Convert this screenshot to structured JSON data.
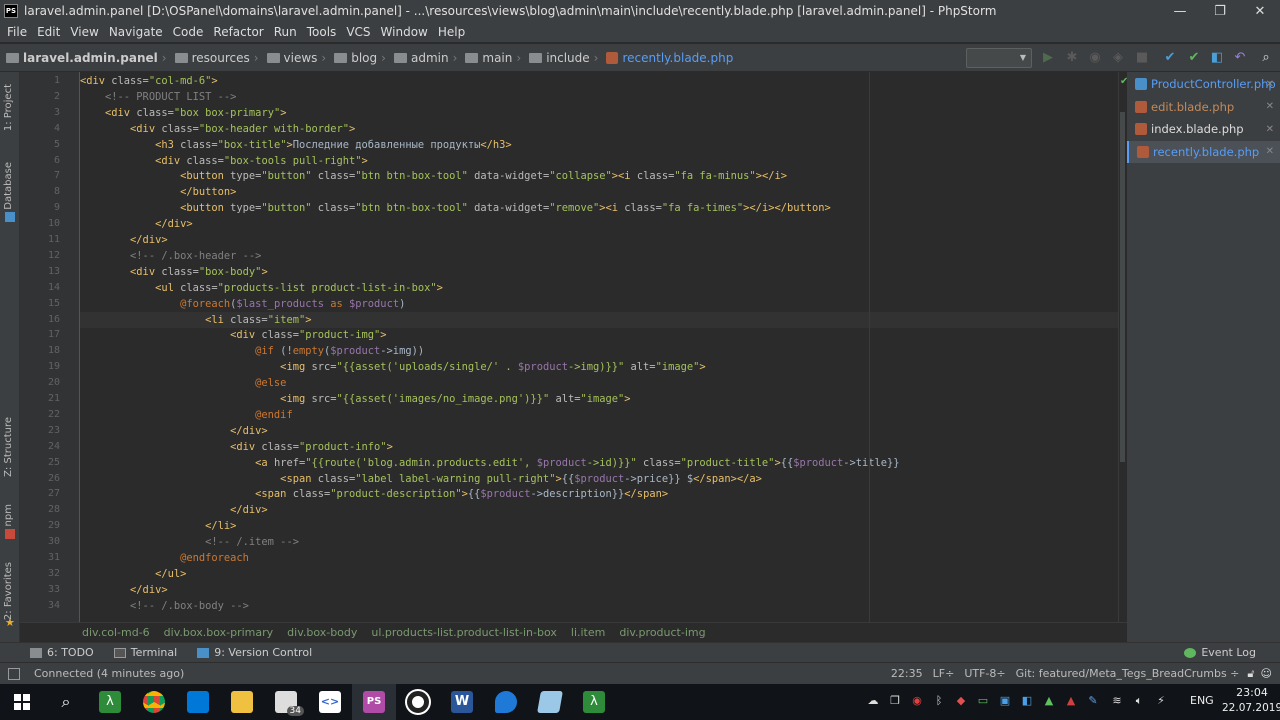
{
  "window": {
    "title": "laravel.admin.panel [D:\\OSPanel\\domains\\laravel.admin.panel] - ...\\resources\\views\\blog\\admin\\main\\include\\recently.blade.php [laravel.admin.panel] - PhpStorm",
    "app_icon": "PS",
    "minimize_glyph": "—",
    "maximize_glyph": "❐",
    "close_glyph": "✕"
  },
  "menu": [
    "File",
    "Edit",
    "View",
    "Navigate",
    "Code",
    "Refactor",
    "Run",
    "Tools",
    "VCS",
    "Window",
    "Help"
  ],
  "breadcrumbs": [
    "laravel.admin.panel",
    "resources",
    "views",
    "blog",
    "admin",
    "main",
    "include",
    "recently.blade.php"
  ],
  "left_tool_tabs": [
    "1: Project",
    "Database",
    "Z: Structure",
    "npm",
    "2: Favorites"
  ],
  "line_numbers": [
    "1",
    "2",
    "3",
    "4",
    "5",
    "6",
    "7",
    "8",
    "9",
    "10",
    "11",
    "12",
    "13",
    "14",
    "15",
    "16",
    "17",
    "18",
    "19",
    "20",
    "21",
    "22",
    "23",
    "24",
    "25",
    "26",
    "27",
    "28",
    "29",
    "30",
    "31",
    "32",
    "33",
    "34"
  ],
  "code_lines": [
    [
      [
        "t-tag",
        "<div "
      ],
      [
        "t-attr",
        "class="
      ],
      [
        "t-str",
        "\"col-md-6\""
      ],
      [
        "t-tag",
        ">"
      ]
    ],
    [
      [
        "t-cmt",
        "    <!-- PRODUCT LIST -->"
      ]
    ],
    [
      [
        "t-tag",
        "    <div "
      ],
      [
        "t-attr",
        "class="
      ],
      [
        "t-str",
        "\"box box-primary\""
      ],
      [
        "t-tag",
        ">"
      ]
    ],
    [
      [
        "t-tag",
        "        <div "
      ],
      [
        "t-attr",
        "class="
      ],
      [
        "t-str",
        "\"box-header with-border\""
      ],
      [
        "t-tag",
        ">"
      ]
    ],
    [
      [
        "t-tag",
        "            <h3 "
      ],
      [
        "t-attr",
        "class="
      ],
      [
        "t-str",
        "\"box-title\""
      ],
      [
        "t-tag",
        ">"
      ],
      [
        "t-txt",
        "Последние добавленные продукты"
      ],
      [
        "t-tag",
        "</h3>"
      ]
    ],
    [
      [
        "t-tag",
        "            <div "
      ],
      [
        "t-attr",
        "class="
      ],
      [
        "t-str",
        "\"box-tools pull-right\""
      ],
      [
        "t-tag",
        ">"
      ]
    ],
    [
      [
        "t-tag",
        "                <button "
      ],
      [
        "t-attr",
        "type="
      ],
      [
        "t-str",
        "\"button\" "
      ],
      [
        "t-attr",
        "class="
      ],
      [
        "t-str",
        "\"btn btn-box-tool\" "
      ],
      [
        "t-attr",
        "data-widget="
      ],
      [
        "t-str",
        "\"collapse\""
      ],
      [
        "t-tag",
        "><i "
      ],
      [
        "t-attr",
        "class="
      ],
      [
        "t-str",
        "\"fa fa-minus\""
      ],
      [
        "t-tag",
        "></i>"
      ]
    ],
    [
      [
        "t-tag",
        "                </button>"
      ]
    ],
    [
      [
        "t-tag",
        "                <button "
      ],
      [
        "t-attr",
        "type="
      ],
      [
        "t-str",
        "\"button\" "
      ],
      [
        "t-attr",
        "class="
      ],
      [
        "t-str",
        "\"btn btn-box-tool\" "
      ],
      [
        "t-attr",
        "data-widget="
      ],
      [
        "t-str",
        "\"remove\""
      ],
      [
        "t-tag",
        "><i "
      ],
      [
        "t-attr",
        "class="
      ],
      [
        "t-str",
        "\"fa fa-times\""
      ],
      [
        "t-tag",
        "></i></button>"
      ]
    ],
    [
      [
        "t-tag",
        "            </div>"
      ]
    ],
    [
      [
        "t-tag",
        "        </div>"
      ]
    ],
    [
      [
        "t-cmt",
        "        <!-- /.box-header -->"
      ]
    ],
    [
      [
        "t-tag",
        "        <div "
      ],
      [
        "t-attr",
        "class="
      ],
      [
        "t-str",
        "\"box-body\""
      ],
      [
        "t-tag",
        ">"
      ]
    ],
    [
      [
        "t-tag",
        "            <ul "
      ],
      [
        "t-attr",
        "class="
      ],
      [
        "t-str",
        "\"products-list product-list-in-box\""
      ],
      [
        "t-tag",
        ">"
      ]
    ],
    [
      [
        "t-dir",
        "                @foreach"
      ],
      [
        "t-txt",
        "("
      ],
      [
        "t-var",
        "$last_products"
      ],
      [
        "t-dir",
        " as "
      ],
      [
        "t-var",
        "$product"
      ],
      [
        "t-txt",
        ")"
      ]
    ],
    [
      [
        "t-tag",
        "                    <li "
      ],
      [
        "t-attr",
        "class="
      ],
      [
        "t-str",
        "\"item\""
      ],
      [
        "t-tag",
        ">"
      ]
    ],
    [
      [
        "t-tag",
        "                        <div "
      ],
      [
        "t-attr",
        "class="
      ],
      [
        "t-str",
        "\"product-img\""
      ],
      [
        "t-tag",
        ">"
      ]
    ],
    [
      [
        "t-dir",
        "                            @if "
      ],
      [
        "t-txt",
        "(!"
      ],
      [
        "t-dir",
        "empty"
      ],
      [
        "t-txt",
        "("
      ],
      [
        "t-var",
        "$product"
      ],
      [
        "t-txt",
        "->img))"
      ]
    ],
    [
      [
        "t-tag",
        "                                <img "
      ],
      [
        "t-attr",
        "src="
      ],
      [
        "t-str",
        "\"{{asset('uploads/single/' . "
      ],
      [
        "t-var",
        "$product"
      ],
      [
        "t-str",
        "->img)}}\" "
      ],
      [
        "t-attr",
        "alt="
      ],
      [
        "t-str",
        "\"image\""
      ],
      [
        "t-tag",
        ">"
      ]
    ],
    [
      [
        "t-dir",
        "                            @else"
      ]
    ],
    [
      [
        "t-tag",
        "                                <img "
      ],
      [
        "t-attr",
        "src="
      ],
      [
        "t-str",
        "\"{{asset('images/no_image.png')}}\" "
      ],
      [
        "t-attr",
        "alt="
      ],
      [
        "t-str",
        "\"image\""
      ],
      [
        "t-tag",
        ">"
      ]
    ],
    [
      [
        "t-dir",
        "                            @endif"
      ]
    ],
    [
      [
        "t-tag",
        "                        </div>"
      ]
    ],
    [
      [
        "t-tag",
        "                        <div "
      ],
      [
        "t-attr",
        "class="
      ],
      [
        "t-str",
        "\"product-info\""
      ],
      [
        "t-tag",
        ">"
      ]
    ],
    [
      [
        "t-tag",
        "                            <a "
      ],
      [
        "t-attr",
        "href="
      ],
      [
        "t-str",
        "\"{{route('blog.admin.products.edit', "
      ],
      [
        "t-var",
        "$product"
      ],
      [
        "t-str",
        "->id)}}\" "
      ],
      [
        "t-attr",
        "class="
      ],
      [
        "t-str",
        "\"product-title\""
      ],
      [
        "t-tag",
        ">"
      ],
      [
        "t-txt",
        "{{"
      ],
      [
        "t-var",
        "$product"
      ],
      [
        "t-txt",
        "->title}}"
      ]
    ],
    [
      [
        "t-tag",
        "                                <span "
      ],
      [
        "t-attr",
        "class="
      ],
      [
        "t-str",
        "\"label label-warning pull-right\""
      ],
      [
        "t-tag",
        ">"
      ],
      [
        "t-txt",
        "{{"
      ],
      [
        "t-var",
        "$product"
      ],
      [
        "t-txt",
        "->price}} $"
      ],
      [
        "t-tag",
        "</span></a>"
      ]
    ],
    [
      [
        "t-tag",
        "                            <span "
      ],
      [
        "t-attr",
        "class="
      ],
      [
        "t-str",
        "\"product-description\""
      ],
      [
        "t-tag",
        ">"
      ],
      [
        "t-txt",
        "{{"
      ],
      [
        "t-var",
        "$product"
      ],
      [
        "t-txt",
        "->description}}"
      ],
      [
        "t-tag",
        "</span>"
      ]
    ],
    [
      [
        "t-tag",
        "                        </div>"
      ]
    ],
    [
      [
        "t-tag",
        "                    </li>"
      ]
    ],
    [
      [
        "t-cmt",
        "                    <!-- /.item -->"
      ]
    ],
    [
      [
        "t-dir",
        "                @endforeach"
      ]
    ],
    [
      [
        "t-tag",
        "            </ul>"
      ]
    ],
    [
      [
        "t-tag",
        "        </div>"
      ]
    ],
    [
      [
        "t-cmt",
        "        <!-- /.box-body -->"
      ]
    ]
  ],
  "file_tabs": [
    {
      "label": "ProductController.php",
      "color": "#589df6",
      "icon_color": "#4a90c8"
    },
    {
      "label": "edit.blade.php",
      "color": "#c38a5c",
      "icon_color": "#b05a3c"
    },
    {
      "label": "index.blade.php",
      "color": "#dddddd",
      "icon_color": "#b05a3c"
    },
    {
      "label": "recently.blade.php",
      "color": "#589df6",
      "icon_color": "#b05a3c"
    }
  ],
  "code_breadcrumbs": [
    "div.col-md-6",
    "div.box.box-primary",
    "div.box-body",
    "ul.products-list.product-list-in-box",
    "li.item",
    "div.product-img"
  ],
  "tool_windows": [
    {
      "label": "6: TODO"
    },
    {
      "label": "Terminal"
    },
    {
      "label": "9: Version Control"
    }
  ],
  "event_log": "Event Log",
  "status": {
    "message": "Connected (4 minutes ago)",
    "position": "22:35",
    "line_sep": "LF÷",
    "encoding": "UTF-8÷",
    "git": "Git: featured/Meta_Tegs_BreadCrumbs ÷"
  },
  "taskbar": {
    "lang": "ENG",
    "time": "23:04",
    "date": "22.07.2019",
    "badge": "34"
  }
}
